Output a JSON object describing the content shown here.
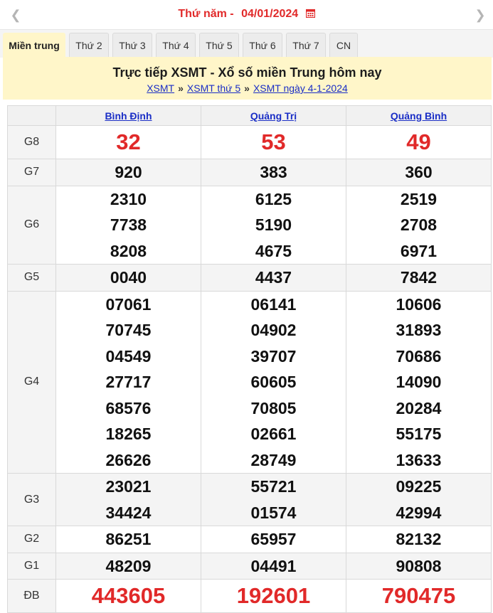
{
  "date_nav": {
    "prev_icon": "chevron-left-icon",
    "next_icon": "chevron-right-icon",
    "weekday": "Thứ năm -",
    "date": "04/01/2024",
    "calendar_icon": "calendar-icon",
    "accent_color": "#e12929"
  },
  "tabs": [
    {
      "label": "Miền trung",
      "active": true
    },
    {
      "label": "Thứ 2"
    },
    {
      "label": "Thứ 3"
    },
    {
      "label": "Thứ 4"
    },
    {
      "label": "Thứ 5"
    },
    {
      "label": "Thứ 6"
    },
    {
      "label": "Thứ 7"
    },
    {
      "label": "CN"
    }
  ],
  "header": {
    "title": "Trực tiếp XSMT - Xổ số miền Trung hôm nay",
    "breadcrumb": [
      "XSMT",
      "XSMT thứ 5",
      "XSMT ngày 4-1-2024"
    ],
    "separator": "»",
    "background": "#fff6c9"
  },
  "results": {
    "provinces": [
      "Bình Định",
      "Quảng Trị",
      "Quảng Bình"
    ],
    "prizes": [
      {
        "label": "G8",
        "values": [
          [
            "32"
          ],
          [
            "53"
          ],
          [
            "49"
          ]
        ]
      },
      {
        "label": "G7",
        "values": [
          [
            "920"
          ],
          [
            "383"
          ],
          [
            "360"
          ]
        ]
      },
      {
        "label": "G6",
        "values": [
          [
            "2310",
            "7738",
            "8208"
          ],
          [
            "6125",
            "5190",
            "4675"
          ],
          [
            "2519",
            "2708",
            "6971"
          ]
        ]
      },
      {
        "label": "G5",
        "values": [
          [
            "0040"
          ],
          [
            "4437"
          ],
          [
            "7842"
          ]
        ]
      },
      {
        "label": "G4",
        "values": [
          [
            "07061",
            "70745",
            "04549",
            "27717",
            "68576",
            "18265",
            "26626"
          ],
          [
            "06141",
            "04902",
            "39707",
            "60605",
            "70805",
            "02661",
            "28749"
          ],
          [
            "10606",
            "31893",
            "70686",
            "14090",
            "20284",
            "55175",
            "13633"
          ]
        ]
      },
      {
        "label": "G3",
        "values": [
          [
            "23021",
            "34424"
          ],
          [
            "55721",
            "01574"
          ],
          [
            "09225",
            "42994"
          ]
        ]
      },
      {
        "label": "G2",
        "values": [
          [
            "86251"
          ],
          [
            "65957"
          ],
          [
            "82132"
          ]
        ]
      },
      {
        "label": "G1",
        "values": [
          [
            "48209"
          ],
          [
            "04491"
          ],
          [
            "90808"
          ]
        ]
      },
      {
        "label": "ĐB",
        "values": [
          [
            "443605"
          ],
          [
            "192601"
          ],
          [
            "790475"
          ]
        ]
      }
    ]
  }
}
